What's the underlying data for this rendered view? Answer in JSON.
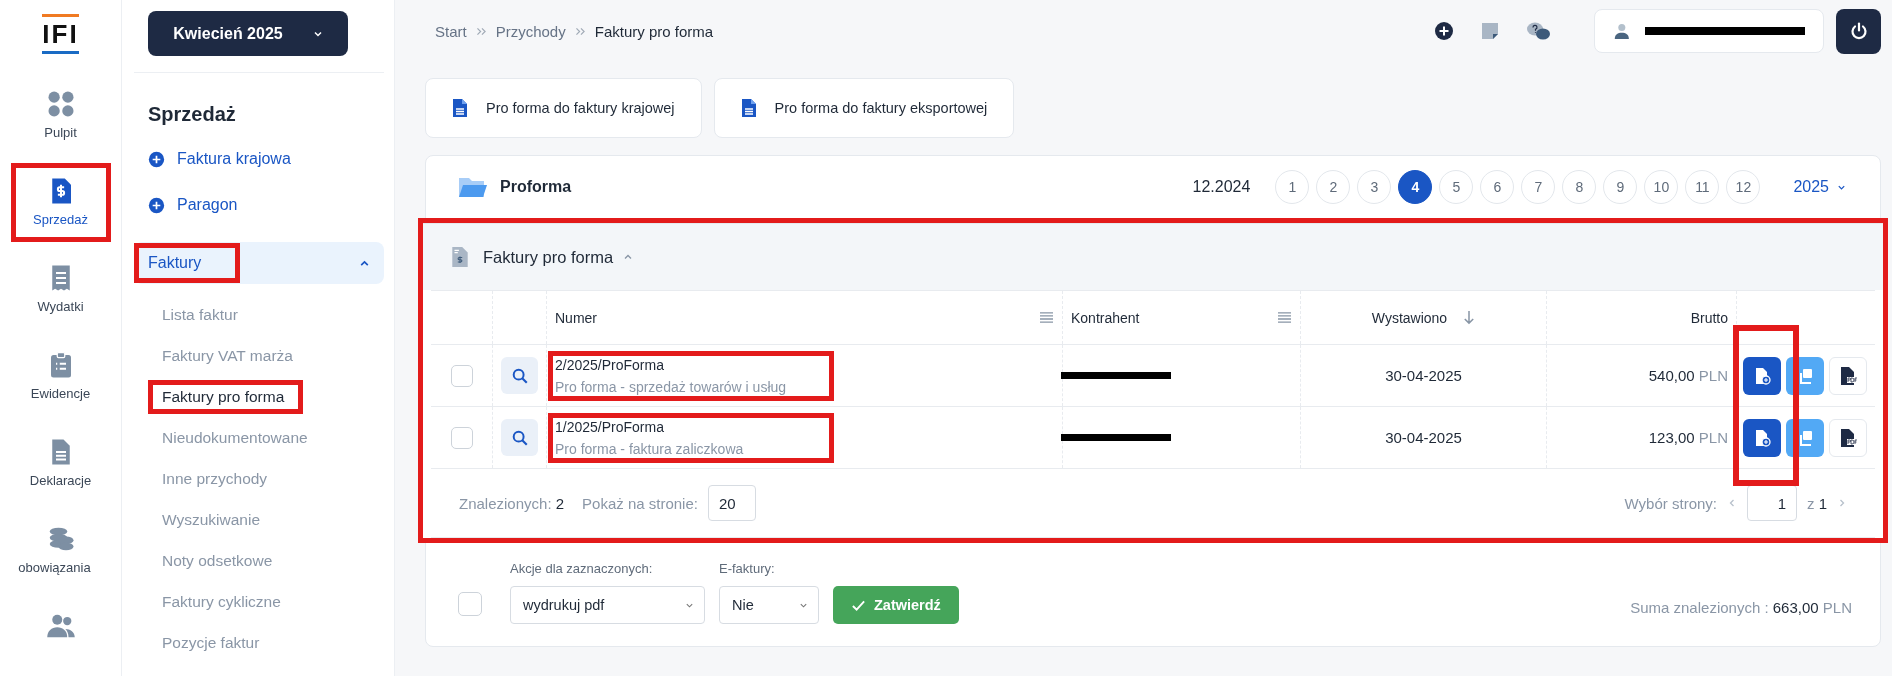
{
  "rail": {
    "logo": "IFI",
    "items": [
      {
        "label": "Pulpit",
        "selected": false,
        "highlighted": false
      },
      {
        "label": "Sprzedaż",
        "selected": true,
        "highlighted": true
      },
      {
        "label": "Wydatki",
        "selected": false,
        "highlighted": false
      },
      {
        "label": "Ewidencje",
        "selected": false,
        "highlighted": false
      },
      {
        "label": "Deklaracje",
        "selected": false,
        "highlighted": false
      },
      {
        "label": "obowiązania",
        "selected": false,
        "highlighted": false
      },
      {
        "selected": false,
        "highlighted": false
      }
    ]
  },
  "month_picker": {
    "label": "Kwiecień 2025"
  },
  "sidebar": {
    "title": "Sprzedaż",
    "actions": [
      "Faktura krajowa",
      "Paragon"
    ],
    "group": {
      "label": "Faktury",
      "expanded": true,
      "highlighted": true,
      "items": [
        {
          "label": "Lista faktur",
          "selected": false,
          "highlighted": false
        },
        {
          "label": "Faktury VAT marża",
          "selected": false,
          "highlighted": false
        },
        {
          "label": "Faktury pro forma",
          "selected": true,
          "highlighted": true
        },
        {
          "label": "Nieudokumentowane",
          "selected": false,
          "highlighted": false
        },
        {
          "label": "Inne przychody",
          "selected": false,
          "highlighted": false
        },
        {
          "label": "Wyszukiwanie",
          "selected": false,
          "highlighted": false
        },
        {
          "label": "Noty odsetkowe",
          "selected": false,
          "highlighted": false
        },
        {
          "label": "Faktury cykliczne",
          "selected": false,
          "highlighted": false
        },
        {
          "label": "Pozycje faktur",
          "selected": false,
          "highlighted": false
        }
      ]
    }
  },
  "breadcrumbs": [
    "Start",
    "Przychody",
    "Faktury pro forma"
  ],
  "create_buttons": [
    "Pro forma do faktury krajowej",
    "Pro forma do faktury eksportowej"
  ],
  "panel": {
    "title": "Proforma",
    "previous_period": "12.2024",
    "months": [
      {
        "label": "1",
        "selected": false
      },
      {
        "label": "2",
        "selected": false
      },
      {
        "label": "3",
        "selected": false
      },
      {
        "label": "4",
        "selected": true
      },
      {
        "label": "5",
        "selected": false
      },
      {
        "label": "6",
        "selected": false
      },
      {
        "label": "7",
        "selected": false
      },
      {
        "label": "8",
        "selected": false
      },
      {
        "label": "9",
        "selected": false
      },
      {
        "label": "10",
        "selected": false
      },
      {
        "label": "11",
        "selected": false
      },
      {
        "label": "12",
        "selected": false
      }
    ],
    "year": "2025"
  },
  "section": {
    "title": "Faktury pro forma",
    "expanded": true,
    "highlighted": true,
    "columns": [
      {
        "label": "Numer",
        "kind": "menu"
      },
      {
        "label": "Kontrahent",
        "kind": "menu"
      },
      {
        "label": "Wystawiono",
        "kind": "sort"
      },
      {
        "label": "Brutto",
        "kind": "plain"
      }
    ],
    "rows": [
      {
        "number": "2/2025/ProForma",
        "type": "Pro forma - sprzedaż towarów i usług",
        "date": "30-04-2025",
        "amount": "540,00",
        "currency": "PLN",
        "checked": false,
        "highlighted": true
      },
      {
        "number": "1/2025/ProForma",
        "type": "Pro forma - faktura zaliczkowa",
        "date": "30-04-2025",
        "amount": "123,00",
        "currency": "PLN",
        "checked": false,
        "highlighted": true
      }
    ],
    "actions_highlighted": true,
    "found_label": "Znalezionych:",
    "found": "2",
    "per_page_label": "Pokaż na stronie:",
    "per_page": "20",
    "page_label": "Wybór strony:",
    "page": "1",
    "of": "z",
    "total_pages": "1"
  },
  "bulk": {
    "checked": false,
    "actions_label": "Akcje dla zaznaczonych:",
    "action": "wydrukuj pdf",
    "efaktury_label": "E-faktury:",
    "efaktury": "Nie",
    "confirm": "Zatwierdź",
    "sum_label": "Suma znalezionych :",
    "sum": "663,00",
    "sum_currency": "PLN"
  }
}
